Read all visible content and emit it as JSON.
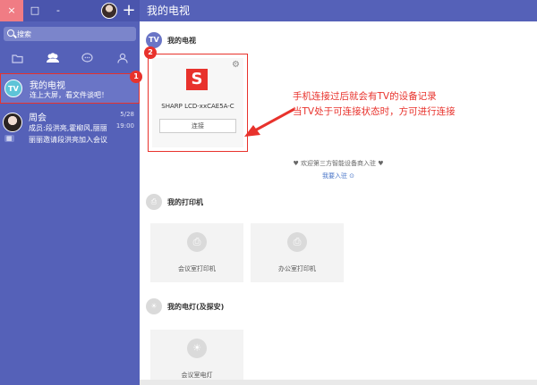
{
  "window": {
    "close_glyph": "×",
    "max_glyph": "□",
    "min_glyph": "-",
    "new_glyph": "+"
  },
  "search": {
    "placeholder": "搜索"
  },
  "tabs": [
    {
      "icon": "folder-icon"
    },
    {
      "icon": "group-icon",
      "active": true
    },
    {
      "icon": "chat-icon"
    },
    {
      "icon": "contact-icon"
    }
  ],
  "chats": {
    "tv": {
      "avatar": "TV",
      "name": "我的电视",
      "subtitle": "连上大屏，看文件谈吧！"
    },
    "group": {
      "name": "周会",
      "time1": "5/28",
      "time2": "19:00",
      "line1": "成员:段洪亮,霍柳风,丽丽",
      "line2": "丽丽邀请段洪亮加入会议"
    }
  },
  "badges": {
    "one": "1",
    "two": "2"
  },
  "header": {
    "title": "我的电视"
  },
  "sections": {
    "tv": {
      "title": "我的电视",
      "icon_text": "TV"
    },
    "printer": {
      "title": "我的打印机"
    },
    "light": {
      "title": "我的电灯(及探安)"
    }
  },
  "device": {
    "logo": "S",
    "name": "SHARP LCD-xxCAE5A-C",
    "connect_label": "连接"
  },
  "annotation": {
    "line1": "手机连接过后就会有TV的设备记录",
    "line2": "当TV处于可连接状态时，方可进行连接"
  },
  "third_party": {
    "welcome": "欢迎第三方智能设备商入驻",
    "join": "我要入驻 ⊙"
  },
  "printers": [
    {
      "label": "会议室打印机"
    },
    {
      "label": "办公室打印机"
    }
  ],
  "lights": [
    {
      "label": "会议室电灯"
    }
  ],
  "colors": {
    "sidebar": "#5561b8",
    "accent_red": "#e8322c",
    "link_blue": "#4a76c8"
  }
}
